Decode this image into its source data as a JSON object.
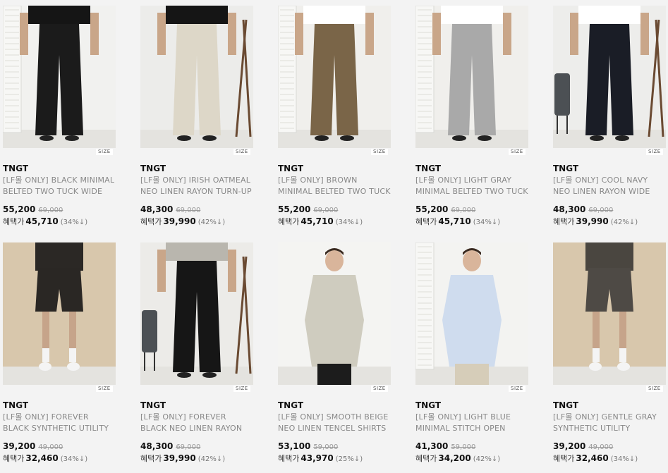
{
  "size_label": "SIZE",
  "benefit_label": "혜택가",
  "products": [
    {
      "brand": "TNGT",
      "name_line1": "[LF몰 ONLY] BLACK MINIMAL",
      "name_line2": "BELTED TWO TUCK WIDE",
      "price": "55,200",
      "original_price": "69,000",
      "benefit_price": "45,710",
      "discount": "(34%↓)",
      "garment": "pants",
      "pants_color": "#1b1b1b",
      "top_color": "#151515",
      "bg_color": "#f1f1ef",
      "prop": "shutter"
    },
    {
      "brand": "TNGT",
      "name_line1": "[LF몰 ONLY] IRISH OATMEAL",
      "name_line2": "NEO LINEN RAYON TURN-UP",
      "price": "48,300",
      "original_price": "69,000",
      "benefit_price": "39,990",
      "discount": "(42%↓)",
      "garment": "pants",
      "pants_color": "#ddd7c8",
      "top_color": "#151515",
      "bg_color": "#ececea",
      "prop": "stand"
    },
    {
      "brand": "TNGT",
      "name_line1": "[LF몰 ONLY] BROWN",
      "name_line2": "MINIMAL BELTED TWO TUCK",
      "price": "55,200",
      "original_price": "69,000",
      "benefit_price": "45,710",
      "discount": "(34%↓)",
      "garment": "pants",
      "pants_color": "#7a6548",
      "top_color": "#ffffff",
      "bg_color": "#f0efec",
      "prop": "shutter"
    },
    {
      "brand": "TNGT",
      "name_line1": "[LF몰 ONLY] LIGHT GRAY",
      "name_line2": "MINIMAL BELTED TWO TUCK",
      "price": "55,200",
      "original_price": "69,000",
      "benefit_price": "45,710",
      "discount": "(34%↓)",
      "garment": "pants",
      "pants_color": "#a9a9a9",
      "top_color": "#ffffff",
      "bg_color": "#f0efec",
      "prop": "shutter"
    },
    {
      "brand": "TNGT",
      "name_line1": "[LF몰 ONLY] COOL NAVY",
      "name_line2": "NEO LINEN RAYON WIDE",
      "price": "48,300",
      "original_price": "69,000",
      "benefit_price": "39,990",
      "discount": "(42%↓)",
      "garment": "pants",
      "pants_color": "#1a1d26",
      "top_color": "#ffffff",
      "bg_color": "#ededeb",
      "prop": "chair-stand"
    },
    {
      "brand": "TNGT",
      "name_line1": "[LF몰 ONLY] FOREVER",
      "name_line2": "BLACK SYNTHETIC UTILITY",
      "price": "39,200",
      "original_price": "49,000",
      "benefit_price": "32,460",
      "discount": "(34%↓)",
      "garment": "shorts",
      "pants_color": "#2a2724",
      "top_color": "#2b2825",
      "bg_color": "#d8c7ac",
      "prop": "none"
    },
    {
      "brand": "TNGT",
      "name_line1": "[LF몰 ONLY] FOREVER",
      "name_line2": "BLACK NEO LINEN RAYON",
      "price": "48,300",
      "original_price": "69,000",
      "benefit_price": "39,990",
      "discount": "(42%↓)",
      "garment": "pants",
      "pants_color": "#161616",
      "top_color": "#b9b6ae",
      "bg_color": "#ecebe8",
      "prop": "chair-stand"
    },
    {
      "brand": "TNGT",
      "name_line1": "[LF몰 ONLY] SMOOTH BEIGE",
      "name_line2": "NEO LINEN TENCEL SHIRTS",
      "price": "53,100",
      "original_price": "59,000",
      "benefit_price": "43,970",
      "discount": "(25%↓)",
      "garment": "shirt",
      "pants_color": "#1c1c1c",
      "top_color": "#cfccbf",
      "bg_color": "#f4f4f2",
      "prop": "none"
    },
    {
      "brand": "TNGT",
      "name_line1": "[LF몰 ONLY] LIGHT BLUE",
      "name_line2": "MINIMAL STITCH OPEN",
      "price": "41,300",
      "original_price": "59,000",
      "benefit_price": "34,200",
      "discount": "(42%↓)",
      "garment": "shirt",
      "pants_color": "#d6cdb9",
      "top_color": "#cfdcee",
      "bg_color": "#f3f3f1",
      "prop": "shutter"
    },
    {
      "brand": "TNGT",
      "name_line1": "[LF몰 ONLY] GENTLE GRAY",
      "name_line2": "SYNTHETIC UTILITY",
      "price": "39,200",
      "original_price": "49,000",
      "benefit_price": "32,460",
      "discount": "(34%↓)",
      "garment": "shorts",
      "pants_color": "#4e4a45",
      "top_color": "#4a4640",
      "bg_color": "#d8c7ac",
      "prop": "none"
    }
  ]
}
